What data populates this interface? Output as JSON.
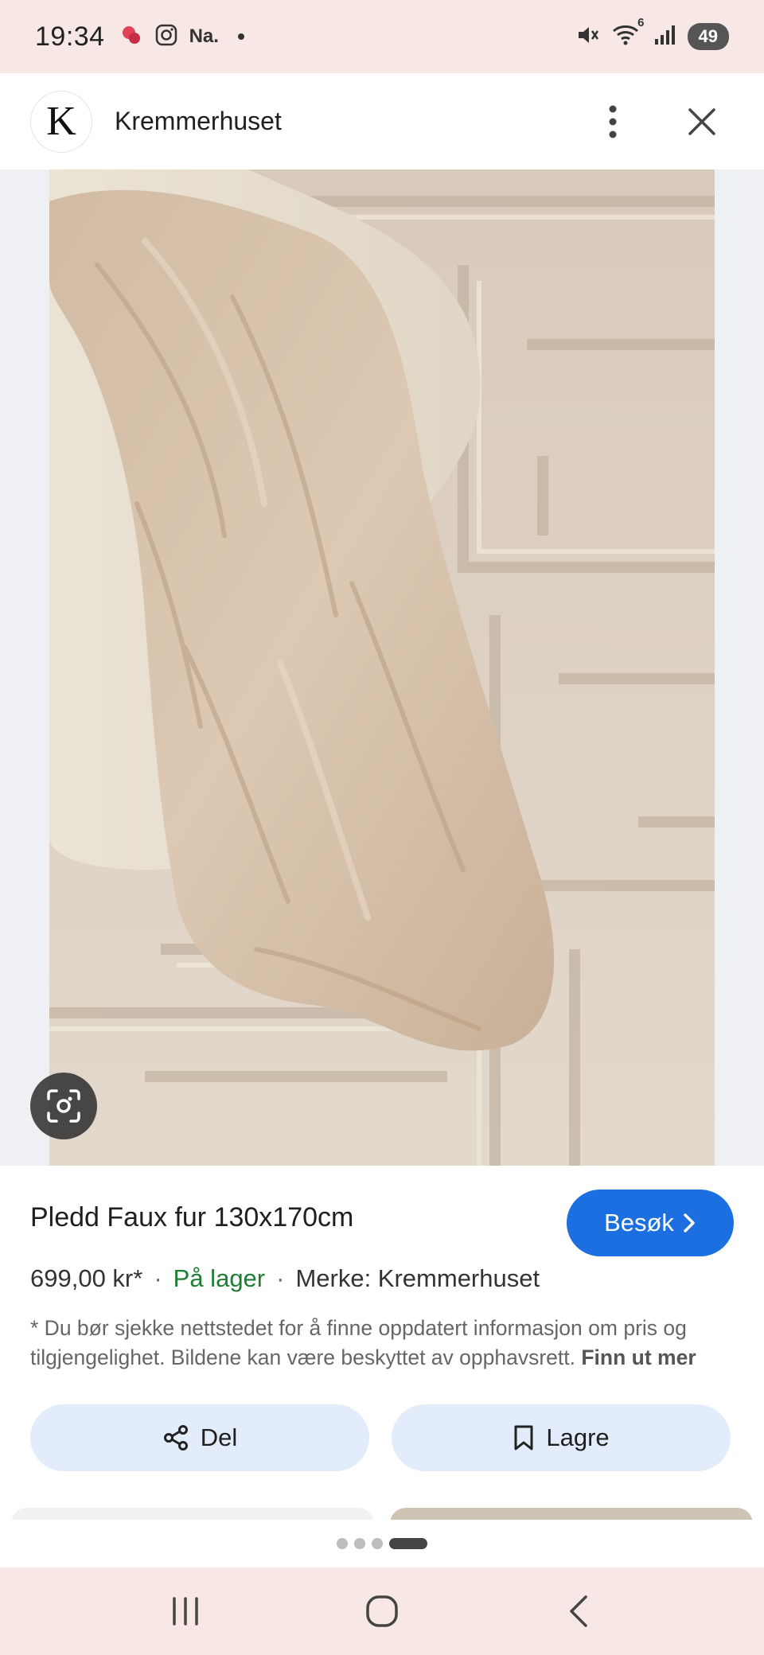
{
  "status_bar": {
    "time": "19:34",
    "notification_text": "Na.",
    "network_badge": "6",
    "battery": "49"
  },
  "header": {
    "logo_letter": "K",
    "site_name": "Kremmerhuset"
  },
  "product": {
    "title": "Pledd Faux fur 130x170cm",
    "visit_label": "Besøk",
    "price": "699,00 kr*",
    "stock": "På lager",
    "brand": "Merke: Kremmerhuset",
    "disclaimer": "* Du bør sjekke nettstedet for å finne oppdatert informasjon om pris og tilgjengelighet. Bildene kan være beskyttet av opphavsrett.",
    "learn_more": "Finn ut mer"
  },
  "actions": {
    "share_label": "Del",
    "save_label": "Lagre"
  },
  "pagination": {
    "total": 4,
    "active": 4
  },
  "icons": {
    "header": [
      "more-vertical-icon",
      "close-icon"
    ],
    "lens": "camera-search-icon",
    "nav": [
      "recent-apps-icon",
      "home-icon",
      "back-icon"
    ]
  },
  "colors": {
    "accent": "#1b6fe0",
    "stock_green": "#1e7e34",
    "chip_bg": "#e3ecfa",
    "system_bar": "#f7e8e6"
  }
}
